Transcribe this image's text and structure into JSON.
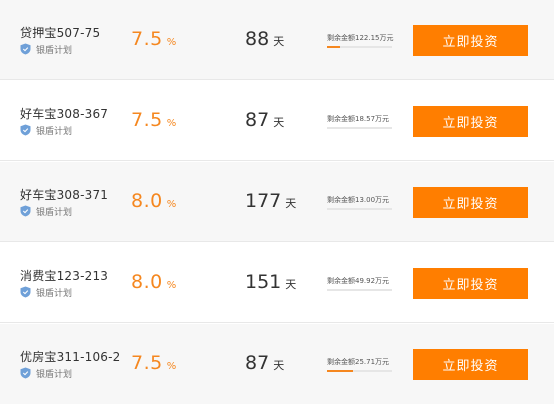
{
  "products": [
    {
      "name": "贷押宝507-75",
      "plan": "银盾计划",
      "rate": "7.5",
      "rate_unit": "%",
      "days": "88",
      "days_unit": "天",
      "remaining": "剩余金额122.15万元",
      "progress": 0.2,
      "button": "立即投资"
    },
    {
      "name": "好车宝308-367",
      "plan": "银盾计划",
      "rate": "7.5",
      "rate_unit": "%",
      "days": "87",
      "days_unit": "天",
      "remaining": "剩余金额18.57万元",
      "progress": 0.0,
      "button": "立即投资"
    },
    {
      "name": "好车宝308-371",
      "plan": "银盾计划",
      "rate": "8.0",
      "rate_unit": "%",
      "days": "177",
      "days_unit": "天",
      "remaining": "剩余金额13.00万元",
      "progress": 0.0,
      "button": "立即投资"
    },
    {
      "name": "消费宝123-213",
      "plan": "银盾计划",
      "rate": "8.0",
      "rate_unit": "%",
      "days": "151",
      "days_unit": "天",
      "remaining": "剩余金额49.92万元",
      "progress": 0.0,
      "button": "立即投资"
    },
    {
      "name": "优房宝311-106-2",
      "plan": "银盾计划",
      "rate": "7.5",
      "rate_unit": "%",
      "days": "87",
      "days_unit": "天",
      "remaining": "剩余金额25.71万元",
      "progress": 0.4,
      "button": "立即投资"
    }
  ],
  "colors": {
    "accent": "#f5871f",
    "button": "#ff7e00",
    "shield": "#6fa0d8"
  },
  "icons": {
    "plan": "shield-icon"
  }
}
